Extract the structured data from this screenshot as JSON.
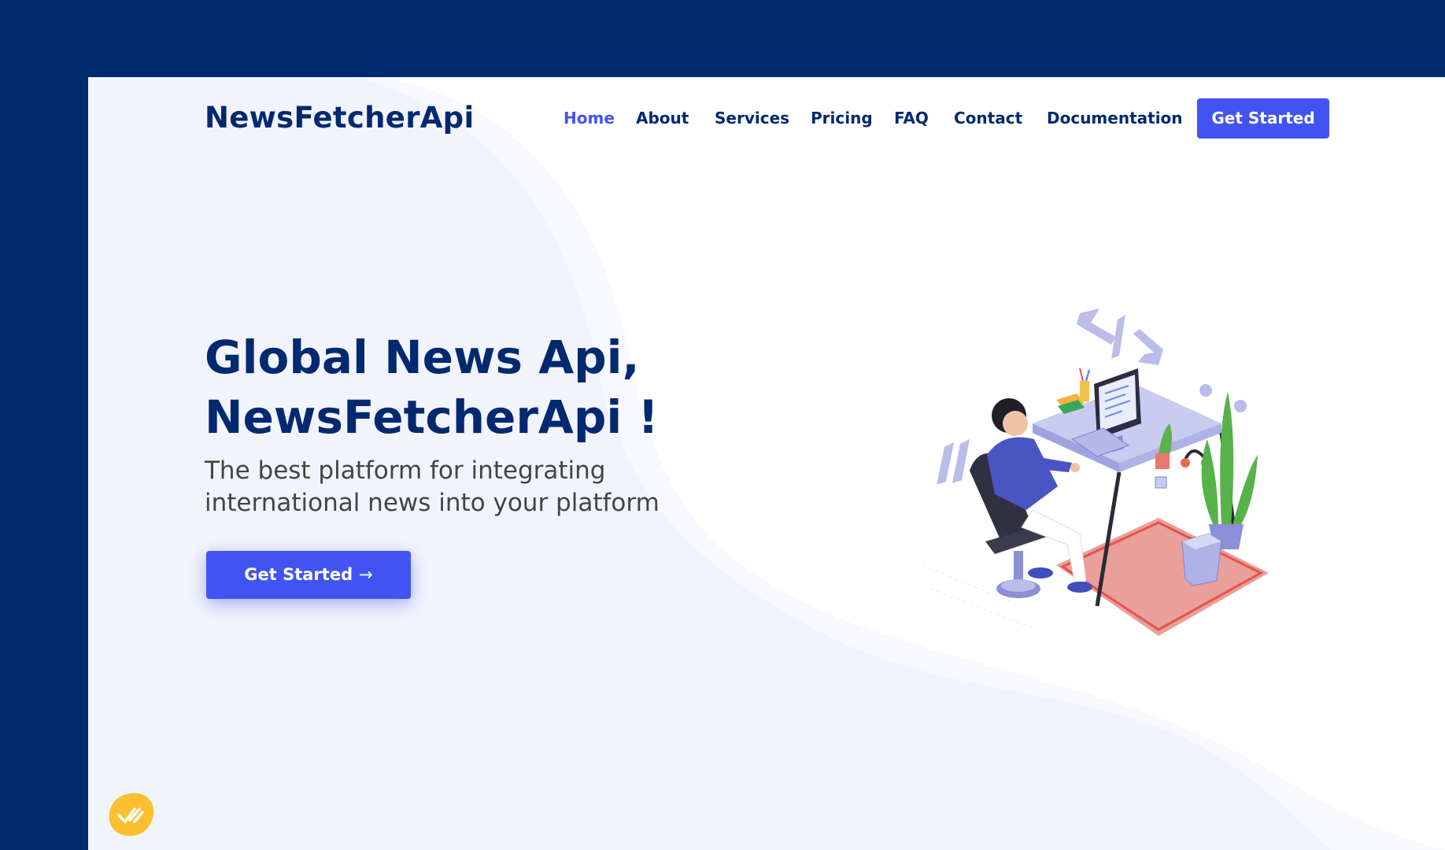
{
  "brand": {
    "logo_text": "NewsFetcherApi"
  },
  "nav": {
    "items": [
      {
        "label": "Home",
        "active": true
      },
      {
        "label": "About",
        "active": false
      },
      {
        "label": "Services",
        "active": false
      },
      {
        "label": "Pricing",
        "active": false
      },
      {
        "label": "FAQ",
        "active": false
      },
      {
        "label": "Contact",
        "active": false
      },
      {
        "label": "Documentation",
        "active": false
      }
    ],
    "cta_label": "Get Started"
  },
  "hero": {
    "title_line1": "Global News Api,",
    "title_line2": "NewsFetcherApi !",
    "subtitle_line1": "The best platform for integrating",
    "subtitle_line2": "international news into your platform",
    "cta_label": "Get Started",
    "cta_icon": "arrow-right-icon"
  },
  "illustration": {
    "icon": "developer-at-desk-illustration"
  },
  "badge": {
    "icon": "checkmark-badge-icon"
  },
  "colors": {
    "outer_background": "#012970",
    "primary_text": "#012970",
    "accent": "#4154f1",
    "body_text": "#444444",
    "badge": "#fbc02d"
  }
}
